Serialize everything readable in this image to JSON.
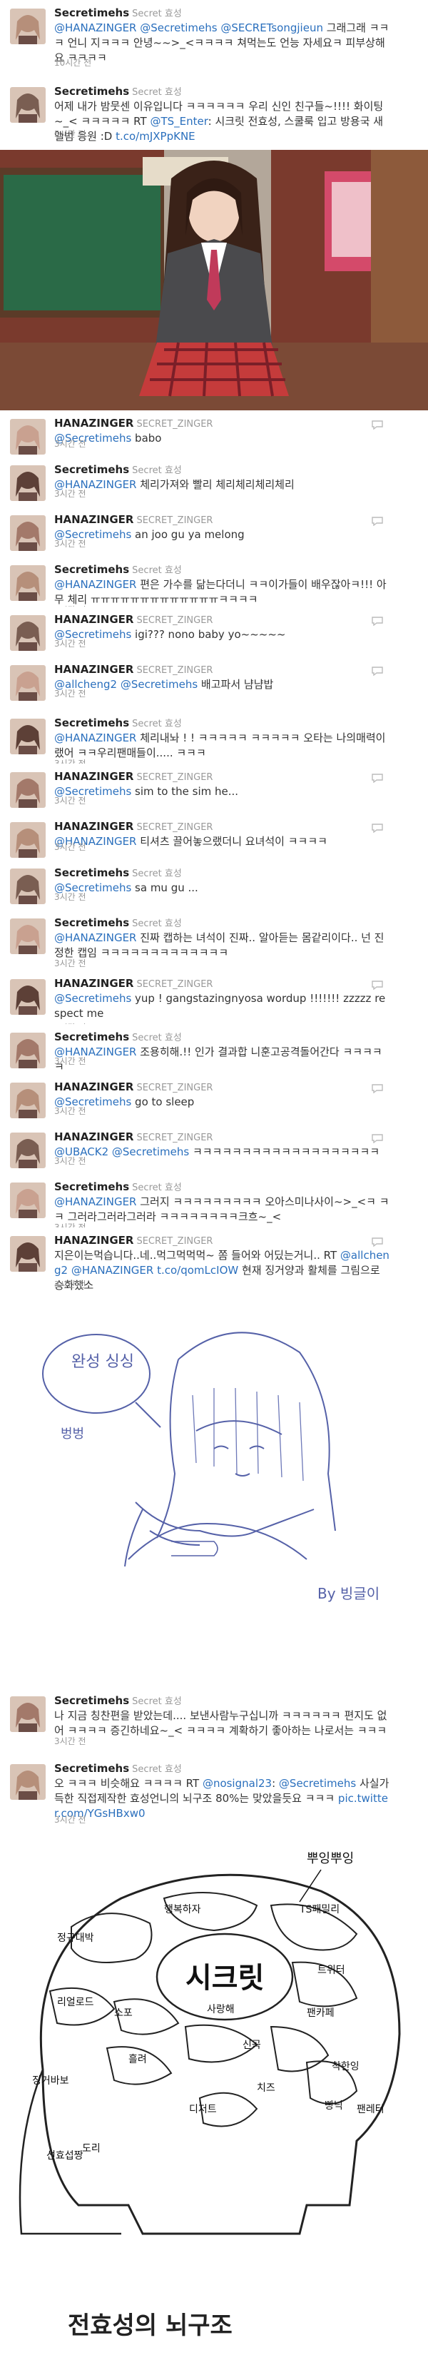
{
  "tweets": [
    {
      "name": "Secretimehs",
      "screen": "Secret 효성",
      "time": "10시간 전",
      "segments": [
        {
          "t": "@HANAZINGER",
          "k": "m"
        },
        {
          "t": " "
        },
        {
          "t": "@Secretimehs",
          "k": "m"
        },
        {
          "t": " "
        },
        {
          "t": "@SECRETsongjieun",
          "k": "m"
        },
        {
          "t": " 그래그래 ㅋㅋㅋ 언니 지ㅋㅋㅋ 안녕~~>_<ㅋㅋㅋㅋ 쳐먹는도 언능 자세요ㅋ 피부상해요 ㅋㅋㅋㅋ"
        }
      ]
    },
    {
      "name": "Secretimehs",
      "screen": "Secret 효성",
      "time": "5시간 전",
      "segments": [
        {
          "t": "어제 내가 밤뭇센 이유입니다 ㅋㅋㅋㅋㅋㅋ 우리 신인 친구들~!!!! 화이팅~_< ㅋㅋㅋㅋㅋ RT "
        },
        {
          "t": "@TS_Enter",
          "k": "m"
        },
        {
          "t": ": 시크릿 전효성, 스쿨룩 입고 방용국 새앨범 응원 :D "
        },
        {
          "t": "t.co/mJXPpKNE",
          "k": "u"
        }
      ]
    },
    {
      "name": "HANAZINGER",
      "screen": "SECRET_ZINGER",
      "time": "3시간 전",
      "segments": [
        {
          "t": "@Secretimehs",
          "k": "m"
        },
        {
          "t": " babo"
        }
      ]
    },
    {
      "name": "Secretimehs",
      "screen": "Secret 효성",
      "time": "3시간 전",
      "segments": [
        {
          "t": "@HANAZINGER",
          "k": "m"
        },
        {
          "t": " 체리가져와 빨리 체리체리체리체리"
        }
      ]
    },
    {
      "name": "HANAZINGER",
      "screen": "SECRET_ZINGER",
      "time": "3시간 전",
      "segments": [
        {
          "t": "@Secretimehs",
          "k": "m"
        },
        {
          "t": " an joo gu ya melong"
        }
      ]
    },
    {
      "name": "Secretimehs",
      "screen": "Secret 효성",
      "time": "3시간 전",
      "segments": [
        {
          "t": "@HANAZINGER",
          "k": "m"
        },
        {
          "t": " 편은 가수를 닮는다더니 ㅋㅋ이가들이 배우잖아ㅋ!!! 아무 체리 ㅠㅠㅠㅠㅠㅠㅠㅠㅠㅠㅠㅠㅠㅋㅋㅋㅋ"
        }
      ]
    },
    {
      "name": "HANAZINGER",
      "screen": "SECRET_ZINGER",
      "time": "3시간 전",
      "segments": [
        {
          "t": "@Secretimehs",
          "k": "m"
        },
        {
          "t": " igi??? nono baby yo~~~~~"
        }
      ]
    },
    {
      "name": "HANAZINGER",
      "screen": "SECRET_ZINGER",
      "time": "3시간 전",
      "segments": [
        {
          "t": "@allcheng2",
          "k": "m"
        },
        {
          "t": " "
        },
        {
          "t": "@Secretimehs",
          "k": "m"
        },
        {
          "t": " 배고파서 냠냠밥"
        }
      ]
    },
    {
      "name": "Secretimehs",
      "screen": "Secret 효성",
      "time": "3시간 전",
      "segments": [
        {
          "t": "@HANAZINGER",
          "k": "m"
        },
        {
          "t": " 체리내놔 ! ! ㅋㅋㅋㅋㅋ ㅋㅋㅋㅋㅋ 오타는 나의매력이랬어 ㅋㅋ우리팬매들이..... ㅋㅋㅋ"
        }
      ]
    },
    {
      "name": "HANAZINGER",
      "screen": "SECRET_ZINGER",
      "time": "3시간 전",
      "segments": [
        {
          "t": "@Secretimehs",
          "k": "m"
        },
        {
          "t": " sim to the sim he..."
        }
      ]
    },
    {
      "name": "HANAZINGER",
      "screen": "SECRET_ZINGER",
      "time": "3시간 전",
      "segments": [
        {
          "t": "@HANAZINGER",
          "k": "m"
        },
        {
          "t": " 티셔츠 끌어놓으랬더니 요녀석이 ㅋㅋㅋㅋ"
        }
      ]
    },
    {
      "name": "Secretimehs",
      "screen": "Secret 효성",
      "time": "3시간 전",
      "segments": [
        {
          "t": "@Secretimehs",
          "k": "m"
        },
        {
          "t": " sa mu gu ..."
        }
      ]
    },
    {
      "name": "Secretimehs",
      "screen": "Secret 효성",
      "time": "3시간 전",
      "segments": [
        {
          "t": "@HANAZINGER",
          "k": "m"
        },
        {
          "t": " 진짜 캡하는 녀석이 진짜.. 알아듣는 몸같리이다.. 넌 진정한 캡임 ㅋㅋㅋㅋㅋㅋㅋㅋㅋㅋㅋㅋㅋ"
        }
      ]
    },
    {
      "name": "HANAZINGER",
      "screen": "SECRET_ZINGER",
      "time": "3시간 전",
      "segments": [
        {
          "t": "@Secretimehs",
          "k": "m"
        },
        {
          "t": " yup ! gangstazingnyosa wordup !!!!!!! zzzzz respect me"
        }
      ]
    },
    {
      "name": "Secretimehs",
      "screen": "Secret 효성",
      "time": "3시간 전",
      "segments": [
        {
          "t": "@HANAZINGER",
          "k": "m"
        },
        {
          "t": " 조용히해.!! 인가 결과합 니훈고공격돌어간다 ㅋㅋㅋㅋㅋ"
        }
      ]
    },
    {
      "name": "HANAZINGER",
      "screen": "SECRET_ZINGER",
      "time": "3시간 전",
      "segments": [
        {
          "t": "@Secretimehs",
          "k": "m"
        },
        {
          "t": " go to sleep"
        }
      ]
    },
    {
      "name": "HANAZINGER",
      "screen": "SECRET_ZINGER",
      "time": "3시간 전",
      "segments": [
        {
          "t": "@UBACK2",
          "k": "m"
        },
        {
          "t": " "
        },
        {
          "t": "@Secretimehs",
          "k": "m"
        },
        {
          "t": " ㅋㅋㅋㅋㅋㅋㅋㅋㅋㅋㅋㅋㅋㅋㅋㅋㅋㅋㅋ"
        }
      ]
    },
    {
      "name": "Secretimehs",
      "screen": "Secret 효성",
      "time": "3시간 전",
      "segments": [
        {
          "t": "@HANAZINGER",
          "k": "m"
        },
        {
          "t": " 그러지 ㅋㅋㅋㅋㅋㅋㅋㅋㅋ 오아스미나사이~>_<ㅋ ㅋㅋ 그러라그러라그러라 ㅋㅋㅋㅋㅋㅋㅋㅋ크흐~_<"
        }
      ]
    },
    {
      "name": "HANAZINGER",
      "screen": "SECRET_ZINGER",
      "time": "3시간 전",
      "segments": [
        {
          "t": "지은이는먹습니다..네..먹그먹먹먹~ 쫌 들어와 어딨는거니.. RT "
        },
        {
          "t": "@allcheng2",
          "k": "m"
        },
        {
          "t": " "
        },
        {
          "t": "@HANAZINGER",
          "k": "m"
        },
        {
          "t": " "
        },
        {
          "t": "t.co/qomLcIOW",
          "k": "u"
        },
        {
          "t": " 현재 징거양과 활체를 그림으로 승화했소"
        }
      ]
    },
    {
      "name": "Secretimehs",
      "screen": "Secret 효성",
      "time": "3시간 전",
      "segments": [
        {
          "t": "나 지금 칭찬편을 받았는데.... 보낸사람누구십니까 ㅋㅋㅋㅋㅋㅋ 편지도 없어 ㅋㅋㅋㅋ 증긴하네요~_< ㅋㅋㅋㅋ 계확하기 좋아하는 나로서는 ㅋㅋㅋ"
        }
      ]
    },
    {
      "name": "Secretimehs",
      "screen": "Secret 효성",
      "time": "3시간 전",
      "segments": [
        {
          "t": "오 ㅋㅋㅋ 비슷해요 ㅋㅋㅋㅋ RT "
        },
        {
          "t": "@nosignal23",
          "k": "m"
        },
        {
          "t": ": "
        },
        {
          "t": "@Secretimehs",
          "k": "m"
        },
        {
          "t": " 사실가득한 직접제작한 효성언니의 뇌구조 80%는 맞았을듯요 ㅋㅋㅋ "
        },
        {
          "t": "pic.twitter.com/YGsHBxw0",
          "k": "u"
        }
      ]
    }
  ],
  "drawing": {
    "bubble_text": "완성 싱싱",
    "side_text": "벙벙",
    "signature": "By 빙글이"
  },
  "brain": {
    "top_label": "뿌잉뿌잉",
    "center_label": "시크릿",
    "labels": [
      "정규대박",
      "행복하자",
      "TS패밀리",
      "트위터",
      "팬카페",
      "리얼로드",
      "착한잉",
      "빵닉",
      "징거바보",
      "소포",
      "사랑해",
      "흘려",
      "디저트",
      "팬레터",
      "신곡",
      "치즈",
      "도리",
      "선효섭짱"
    ],
    "caption": "전효성의 뇌구조"
  },
  "colors": {
    "link": "#2a6fbd",
    "name": "#222222",
    "meta": "#999999",
    "text": "#333333"
  }
}
